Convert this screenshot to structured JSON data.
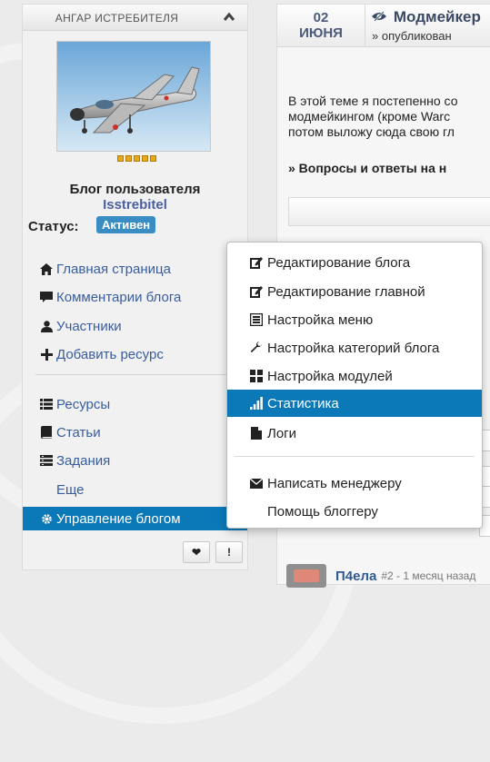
{
  "sidebar": {
    "title": "АНГАР ИСТРЕБИТЕЛЯ",
    "blog_label": "Блог пользователя",
    "username": "Isstrebitel",
    "status_label": "Статус:",
    "status_value": "Активен",
    "nav": [
      {
        "label": "Главная страница",
        "icon": "home-icon"
      },
      {
        "label": "Комментарии блога",
        "icon": "comment-icon"
      },
      {
        "label": "Участники",
        "icon": "user-icon"
      },
      {
        "label": "Добавить ресурс",
        "icon": "plus-icon"
      },
      {
        "label": "Ресурсы",
        "icon": "list-icon"
      },
      {
        "label": "Статьи",
        "icon": "book-icon"
      },
      {
        "label": "Задания",
        "icon": "tasks-icon"
      },
      {
        "label": "Еще",
        "icon": ""
      },
      {
        "label": "Управление блогом",
        "icon": "gear-icon"
      }
    ],
    "buttons": {
      "like": "❤",
      "report": "!"
    }
  },
  "post": {
    "date_day": "02",
    "date_month": "ИЮНЯ",
    "title": "Модмейкер",
    "subtitle": "» опубликован",
    "body_lines": [
      "В этой теме я постепенно со",
      "модмейкингом (кроме Warc",
      "потом выложу сюда свою гл"
    ],
    "qa_link": "» Вопросы и ответы на н"
  },
  "comment": {
    "author": "П4ела",
    "meta": "#2 - 1 месяц назад"
  },
  "dropdown": {
    "items": [
      {
        "label": "Редактирование блога",
        "icon": "edit-icon"
      },
      {
        "label": "Редактирование главной",
        "icon": "edit-icon"
      },
      {
        "label": "Настройка меню",
        "icon": "menu-list-icon"
      },
      {
        "label": "Настройка категорий блога",
        "icon": "wrench-icon"
      },
      {
        "label": "Настройка модулей",
        "icon": "grid-icon"
      },
      {
        "label": "Статистика",
        "icon": "bar-chart-icon"
      },
      {
        "label": "Логи",
        "icon": "file-icon"
      },
      {
        "label": "Написать менеджеру",
        "icon": "envelope-icon"
      },
      {
        "label": "Помощь блоггеру",
        "icon": ""
      }
    ]
  },
  "colors": {
    "accent": "#0b79b8",
    "status_badge": "#3a8dc2",
    "link": "#385d9e"
  }
}
